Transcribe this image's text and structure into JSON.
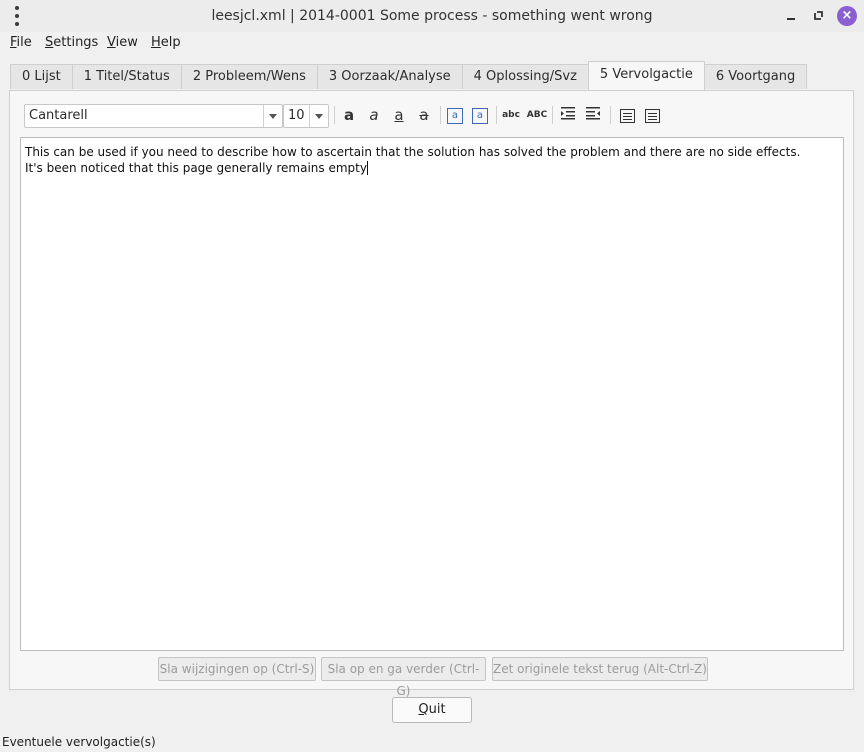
{
  "window": {
    "title": "leesjcl.xml | 2014-0001 Some process - something went wrong",
    "minimize_icon": "minimize-icon",
    "restore_icon": "restore-icon",
    "close_icon": "close-icon"
  },
  "menu": {
    "items": [
      {
        "accel": "F",
        "rest": "ile"
      },
      {
        "accel": "S",
        "rest": "ettings"
      },
      {
        "accel": "V",
        "rest": "iew"
      },
      {
        "accel": "H",
        "rest": "elp"
      }
    ]
  },
  "tabs": [
    {
      "label": "0 Lijst"
    },
    {
      "label": "1 Titel/Status"
    },
    {
      "label": "2 Probleem/Wens"
    },
    {
      "label": "3 Oorzaak/Analyse"
    },
    {
      "label": "4 Oplossing/Svz"
    },
    {
      "label": "5 Vervolgactie",
      "active": true
    },
    {
      "label": "6 Voortgang"
    }
  ],
  "toolbar": {
    "font_family": "Cantarell",
    "font_size": "10",
    "bold_glyph": "a",
    "italic_glyph": "a",
    "underline_glyph": "a",
    "strike_glyph": "a",
    "spell_small": "abc",
    "spell_caps": "ABC",
    "icons": [
      "bold-icon",
      "italic-icon",
      "underline-icon",
      "strikethrough-icon",
      "enlarge-text-icon",
      "shrink-text-icon",
      "spellcheck-lower-icon",
      "spellcheck-upper-icon",
      "indent-icon",
      "dedent-icon",
      "unordered-list-icon",
      "ordered-list-icon"
    ]
  },
  "editor": {
    "line1": "This can be used if you need to describe how to ascertain that the solution has solved the problem and there are no side effects.",
    "line2": "It's been noticed that this page generally remains empty"
  },
  "buttons": {
    "save": "Sla wijzigingen op (Ctrl-S)",
    "save_next": "Sla op en ga verder (Ctrl-G)",
    "revert": "Zet originele tekst terug (Alt-Ctrl-Z)",
    "quit_accel": "Q",
    "quit_rest": "uit"
  },
  "status": {
    "text": "Eventuele vervolgactie(s)"
  }
}
